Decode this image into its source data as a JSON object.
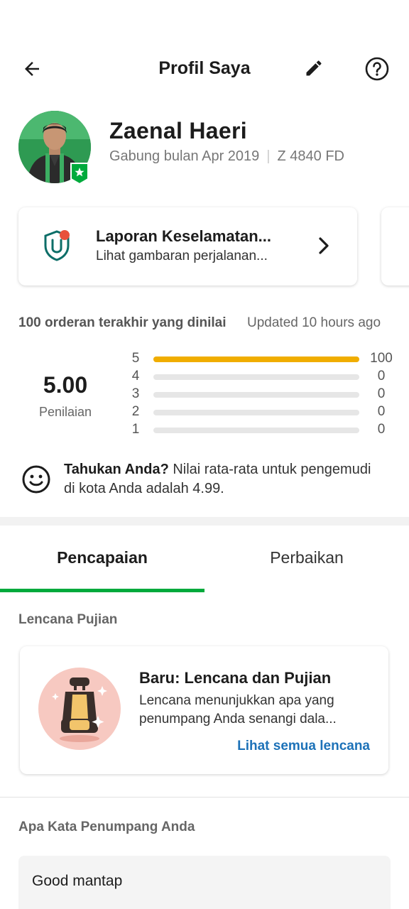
{
  "header": {
    "title": "Profil Saya"
  },
  "profile": {
    "name": "Zaenal Haeri",
    "joined": "Gabung bulan Apr 2019",
    "plate": "Z 4840 FD"
  },
  "safety_card": {
    "title": "Laporan Keselamatan...",
    "subtitle": "Lihat gambaran perjalanan..."
  },
  "ratings": {
    "orders_caption": "100 orderan terakhir yang dinilai",
    "updated": "Updated 10 hours ago",
    "score": "5.00",
    "score_label": "Penilaian",
    "rows": [
      {
        "star": "5",
        "count": "100",
        "fraction": 1.0
      },
      {
        "star": "4",
        "count": "0",
        "fraction": 0.0
      },
      {
        "star": "3",
        "count": "0",
        "fraction": 0.0
      },
      {
        "star": "2",
        "count": "0",
        "fraction": 0.0
      },
      {
        "star": "1",
        "count": "0",
        "fraction": 0.0
      }
    ],
    "bar_color": "#f0ad00"
  },
  "tip": {
    "lead": "Tahukan Anda?",
    "text": " Nilai rata-rata untuk pengemudi di kota Anda adalah 4.99."
  },
  "tabs": [
    {
      "label": "Pencapaian",
      "active": true
    },
    {
      "label": "Perbaikan",
      "active": false
    }
  ],
  "accent_color": "#00aa3c",
  "badges": {
    "section_label": "Lencana Pujian",
    "card_title": "Baru: Lencana dan Pujian",
    "card_desc": "Lencana menunjukkan apa yang penumpang Anda senangi dala...",
    "link": "Lihat semua lencana"
  },
  "reviews": {
    "section_label": "Apa Kata Penumpang Anda",
    "items": [
      "Good mantap"
    ]
  },
  "icons": {
    "back": "arrow-left-icon",
    "edit": "pencil-icon",
    "help": "question-circle-icon",
    "safety": "shield-icon",
    "chevron": "chevron-right-icon",
    "tip": "smiley-icon",
    "badge": "star-badge-icon",
    "seat": "car-seat-icon"
  }
}
